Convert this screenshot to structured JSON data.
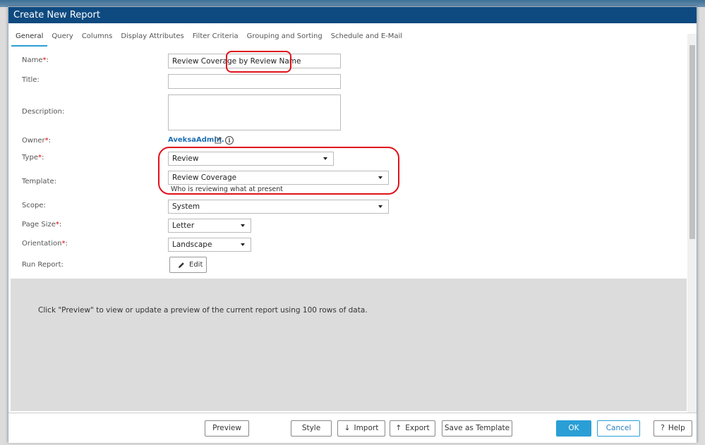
{
  "dialog": {
    "title": "Create New Report"
  },
  "tabs": [
    {
      "label": "General"
    },
    {
      "label": "Query"
    },
    {
      "label": "Columns"
    },
    {
      "label": "Display Attributes"
    },
    {
      "label": "Filter Criteria"
    },
    {
      "label": "Grouping and Sorting"
    },
    {
      "label": "Schedule and E-Mail"
    }
  ],
  "form": {
    "name": {
      "label": "Name",
      "required": "*",
      "value": "Review Coverage by Review Name"
    },
    "title": {
      "label": "Title:",
      "value": ""
    },
    "description": {
      "label": "Description:",
      "value": ""
    },
    "owner": {
      "label": "Owner",
      "required": "*",
      "value": "AveksaAdmin."
    },
    "type": {
      "label": "Type",
      "required": "*",
      "value": "Review"
    },
    "template": {
      "label": "Template:",
      "value": "Review Coverage",
      "hint": "Who is reviewing what at present"
    },
    "scope": {
      "label": "Scope:",
      "value": "System"
    },
    "page_size": {
      "label": "Page Size",
      "required": "*",
      "value": "Letter"
    },
    "orientation": {
      "label": "Orientation",
      "required": "*",
      "value": "Landscape"
    },
    "run_report": {
      "label": "Run Report:",
      "button_label": "Edit"
    },
    "colon": ":"
  },
  "preview": {
    "message": "Click \"Preview\" to view or update a preview of the current report using 100 rows of data."
  },
  "footer": {
    "preview_label": "Preview",
    "style_label": "Style",
    "import_label": "Import",
    "export_label": "Export",
    "save_template_label": "Save as Template",
    "ok_label": "OK",
    "cancel_label": "Cancel",
    "help_label": "Help"
  },
  "icons": {
    "info": "i",
    "help": "?",
    "import": "↓",
    "export": "↑"
  },
  "colors": {
    "title_bar": "#0e4a80",
    "accent": "#2a9fd6",
    "required": "#dd0000",
    "annotation": "#e0121c",
    "link": "#1c6eb2"
  }
}
